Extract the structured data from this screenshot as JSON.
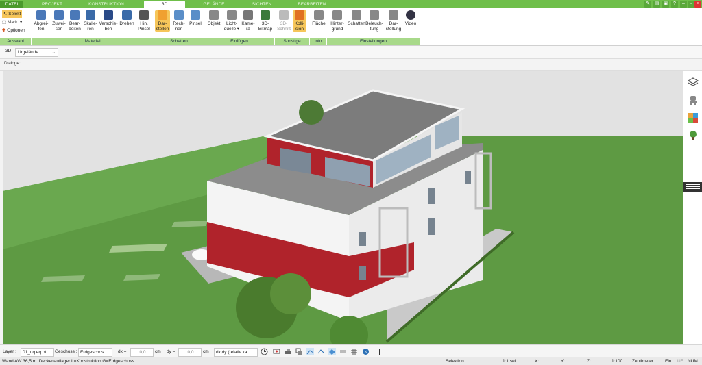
{
  "tabs": [
    "DATEI",
    "PROJEKT",
    "KONSTRUKTION",
    "3D",
    "GELÄNDE",
    "SICHTEN",
    "BEARBEITEN"
  ],
  "auswahl": {
    "selekt": "Selekt",
    "mark": "Mark.",
    "optionen": "Optionen"
  },
  "ribbon_buttons": [
    {
      "l1": "Abgrei-",
      "l2": "fen"
    },
    {
      "l1": "Zuwei-",
      "l2": "sen"
    },
    {
      "l1": "Bear-",
      "l2": "beiten"
    },
    {
      "l1": "Skalie-",
      "l2": "ren"
    },
    {
      "l1": "Verschie-",
      "l2": "ben"
    },
    {
      "l1": "Drehen",
      "l2": ""
    },
    {
      "l1": "Hin.",
      "l2": "Pinsel"
    },
    {
      "l1": "Dar-",
      "l2": "stellen"
    },
    {
      "l1": "Rech-",
      "l2": "nen"
    },
    {
      "l1": "Pinsel",
      "l2": ""
    },
    {
      "l1": "Objekt",
      "l2": ""
    },
    {
      "l1": "Licht-",
      "l2": "quelle ▾"
    },
    {
      "l1": "Kame-",
      "l2": "ra"
    },
    {
      "l1": "3D-",
      "l2": "Bitmap"
    },
    {
      "l1": "3D-",
      "l2": "Schnitt"
    },
    {
      "l1": "Kolli-",
      "l2": "sion"
    },
    {
      "l1": "Fläche",
      "l2": ""
    },
    {
      "l1": "Hinter-",
      "l2": "grund"
    },
    {
      "l1": "Schatten",
      "l2": ""
    },
    {
      "l1": "Beleuch-",
      "l2": "tung"
    },
    {
      "l1": "Dar-",
      "l2": "stellung"
    },
    {
      "l1": "Video",
      "l2": ""
    }
  ],
  "groups": [
    "Auswahl",
    "Material",
    "Schatten",
    "Einfügen",
    "Sonstige",
    "Info",
    "Einstellungen"
  ],
  "toolbar": {
    "mode": "3D",
    "terrain": "Urgelände",
    "dialoge": "Dialoge:"
  },
  "bottom": {
    "layer_label": "Layer :",
    "layer_value": "01_uq.eq.ot",
    "geschoss_label": "Geschoss :",
    "geschoss_value": "Erdgeschos",
    "dx_label": "dx =",
    "dx_value": "0,0",
    "unit1": "cm",
    "dy_label": "dy =",
    "dy_value": "0,0",
    "unit2": "cm",
    "mode_value": "dx,dy (relativ ka"
  },
  "status": {
    "message": "Wand AW 36,5 m. Deckenauflager L=Konstruktion G=Erdgeschoss",
    "selection": "Selektion",
    "sel_count": "1:1 sel",
    "x": "X:",
    "y": "Y:",
    "z": "Z:",
    "scale": "1:100",
    "unit": "Zentimeter",
    "ein": "Ein",
    "uf": "UF",
    "num": "NUM"
  },
  "colors": {
    "tabbar": "#6fbf4a",
    "group": "#a8d98a",
    "highlight": "#f6c65a",
    "wall_red": "#b0232b",
    "lawn": "#5e9a43"
  }
}
